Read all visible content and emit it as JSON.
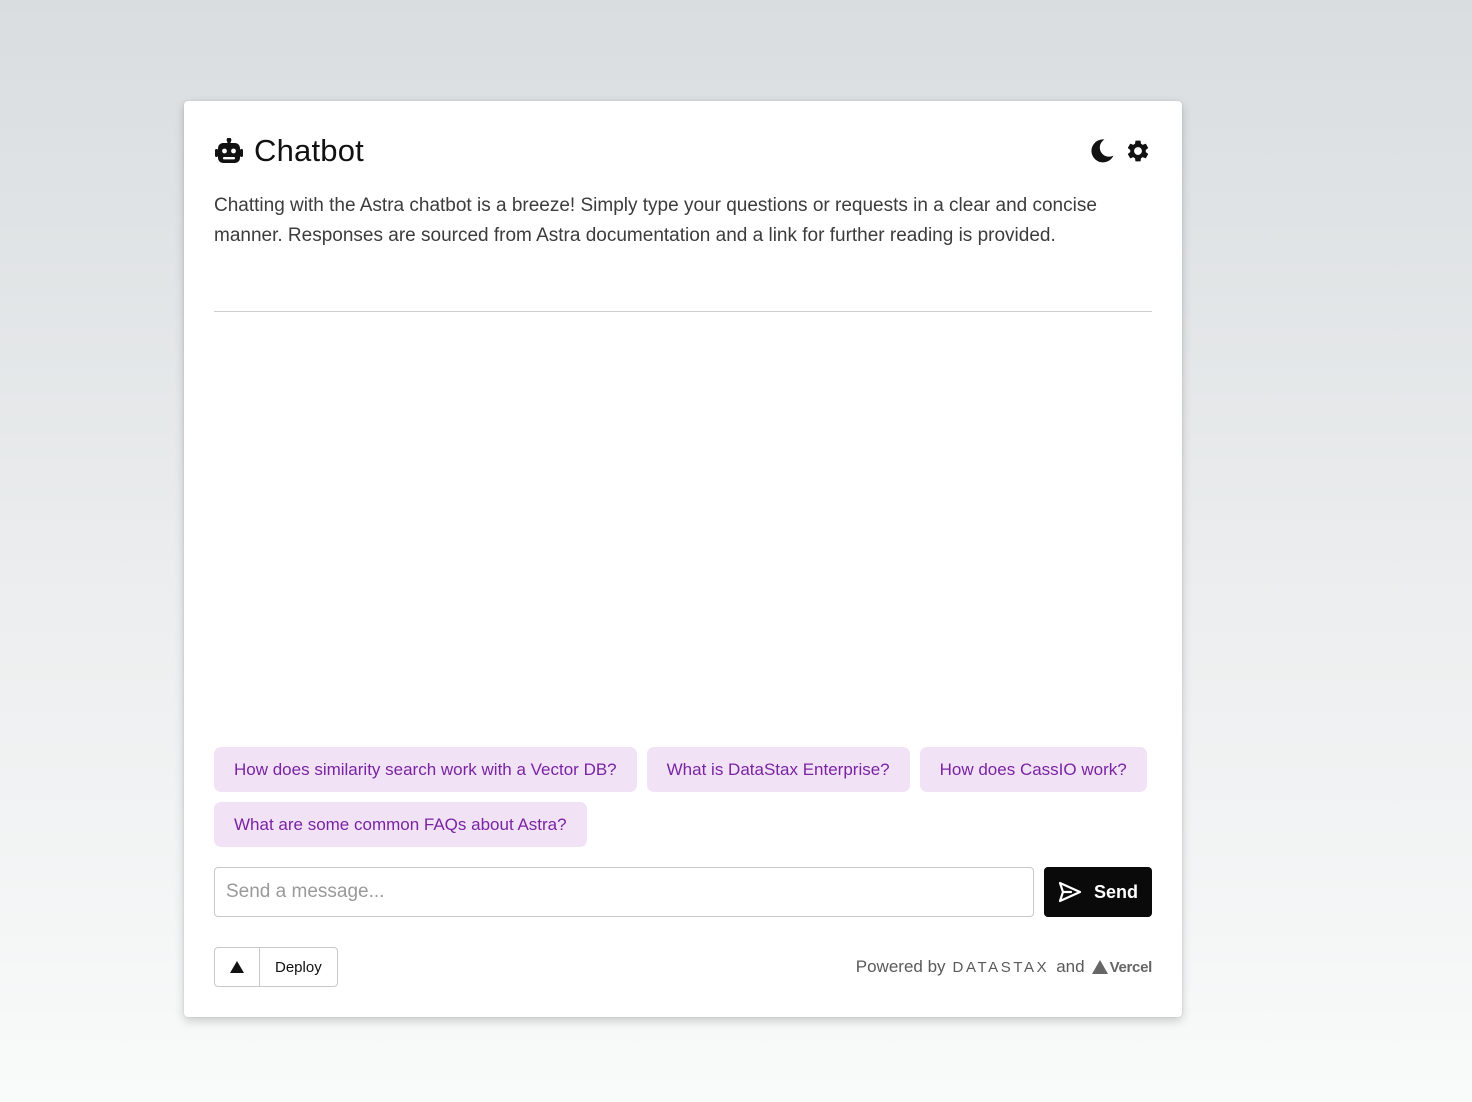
{
  "header": {
    "title": "Chatbot",
    "icons": [
      "robot-icon",
      "moon-icon",
      "gear-icon"
    ]
  },
  "description": "Chatting with the Astra chatbot is a breeze! Simply type your questions or requests in a clear and concise manner. Responses are sourced from Astra documentation and a link for further reading is provided.",
  "suggestions": [
    "How does similarity search work with a Vector DB?",
    "What is DataStax Enterprise?",
    "How does CassIO work?",
    "What are some common FAQs about Astra?"
  ],
  "composer": {
    "placeholder": "Send a message...",
    "send_label": "Send"
  },
  "footer": {
    "deploy_label": "Deploy",
    "powered_by": "Powered by",
    "datastax": "DATASTAX",
    "and": "and",
    "vercel": "Vercel"
  },
  "colors": {
    "chip_bg": "#f1e2f6",
    "chip_text": "#7a24a3",
    "send_bg": "#0a0a0a"
  }
}
